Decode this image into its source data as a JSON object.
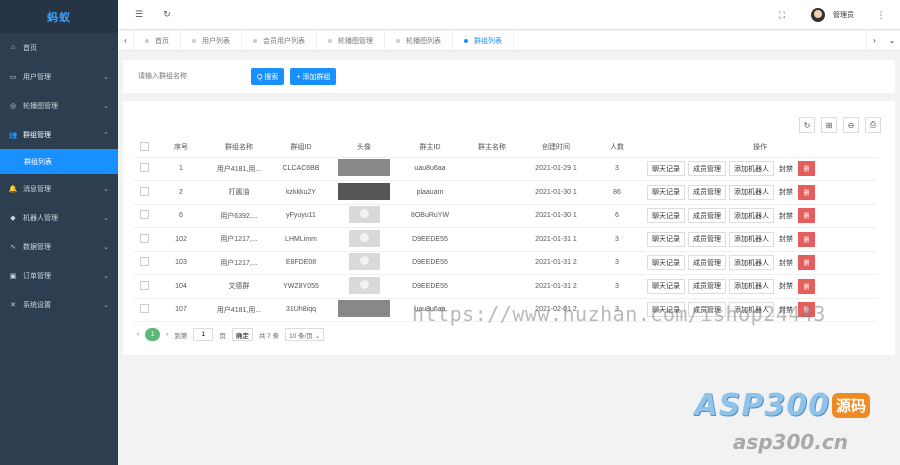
{
  "sidebar": {
    "logo": "蚂蚁",
    "items": [
      {
        "label": "首页",
        "icon": "home-icon",
        "glyph": "⌂",
        "chevron": ""
      },
      {
        "label": "用户管理",
        "icon": "user-icon",
        "glyph": "▭",
        "chevron": "⌄"
      },
      {
        "label": "轮播图管理",
        "icon": "image-icon",
        "glyph": "◎",
        "chevron": "⌄"
      },
      {
        "label": "群组管理",
        "icon": "group-icon",
        "glyph": "👥",
        "chevron": "⌃"
      }
    ],
    "submenu": {
      "label": "群组列表"
    },
    "items_after": [
      {
        "label": "消息管理",
        "icon": "bell-icon",
        "glyph": "🔔",
        "chevron": "⌄"
      },
      {
        "label": "机器人管理",
        "icon": "robot-icon",
        "glyph": "◆",
        "chevron": "⌄"
      },
      {
        "label": "数据管理",
        "icon": "chart-icon",
        "glyph": "∿",
        "chevron": "⌄"
      },
      {
        "label": "订单管理",
        "icon": "order-icon",
        "glyph": "▣",
        "chevron": "⌄"
      },
      {
        "label": "系统设置",
        "icon": "settings-icon",
        "glyph": "✕",
        "chevron": "⌄"
      }
    ]
  },
  "header": {
    "menu_glyph": "☰",
    "refresh_glyph": "↻",
    "fullscreen_glyph": "⛶",
    "user": "管理员",
    "more_glyph": "⋮"
  },
  "tabs": {
    "prev": "‹",
    "next": "›",
    "more": "⌄",
    "items": [
      {
        "label": "首页",
        "active": false
      },
      {
        "label": "用户列表",
        "active": false
      },
      {
        "label": "会员用户列表",
        "active": false
      },
      {
        "label": "轮播图管理",
        "active": false
      },
      {
        "label": "轮播图列表",
        "active": false
      },
      {
        "label": "群组列表",
        "active": true
      }
    ]
  },
  "search": {
    "placeholder": "请输入群组名称",
    "search_label": "Q 搜索",
    "add_label": "+ 添加群组"
  },
  "toolbar": {
    "refresh": "↻",
    "columns": "⊞",
    "export": "⊖",
    "print": "⎙"
  },
  "table": {
    "headers": [
      "",
      "序号",
      "群组名称",
      "群组ID",
      "头像",
      "群主ID",
      "群主名称",
      "创建时间",
      "人数",
      "操作"
    ],
    "rows": [
      {
        "seq": "1",
        "name": "用户4181,用...",
        "gid": "CLCAC6BB",
        "avatar": "photo",
        "owner": "uau8u6aa",
        "owner_name": "",
        "created": "2021-01-29 1",
        "count": "3"
      },
      {
        "seq": "2",
        "name": "打酱油",
        "gid": "kzkkku2Y",
        "avatar": "dark",
        "owner": "plaauam",
        "owner_name": "",
        "created": "2021-01-30 1",
        "count": "86"
      },
      {
        "seq": "6",
        "name": "用户6392,...",
        "gid": "yFyuyu11",
        "avatar": "person",
        "owner": "8OBuRuYW",
        "owner_name": "",
        "created": "2021-01-30 1",
        "count": "6"
      },
      {
        "seq": "102",
        "name": "用户1217,...",
        "gid": "LHMLimm",
        "avatar": "person",
        "owner": "D9EEDE55",
        "owner_name": "",
        "created": "2021-01-31 1",
        "count": "3"
      },
      {
        "seq": "103",
        "name": "用户1217,...",
        "gid": "E8FDE08",
        "avatar": "person",
        "owner": "D9EEDE55",
        "owner_name": "",
        "created": "2021-01-31 2",
        "count": "3"
      },
      {
        "seq": "104",
        "name": "文德群",
        "gid": "YWZ8Y055",
        "avatar": "person",
        "owner": "D9EEDE55",
        "owner_name": "",
        "created": "2021-01-31 2",
        "count": "3"
      },
      {
        "seq": "107",
        "name": "用户4181,用...",
        "gid": "31Uh8iqq",
        "avatar": "photo",
        "owner": "uau8u6aa",
        "owner_name": "",
        "created": "2021-02-01 2",
        "count": "3"
      }
    ],
    "ops": {
      "chat": "聊天记录",
      "members": "成员管理",
      "add_robot": "添加机器人",
      "ban": "封禁",
      "delete": "删"
    }
  },
  "pager": {
    "prev": "‹",
    "current": "1",
    "next": "›",
    "goto_label": "到第",
    "goto_value": "1",
    "page_unit": "页",
    "confirm": "确定",
    "total": "共 7 条",
    "per_page": "10 条/页 ⌄"
  },
  "watermark": {
    "url": "https://www.huzhan.com/ishop24443",
    "brand": "ASP300",
    "brand_tag": "源码",
    "domain": "asp300.cn"
  },
  "colors": {
    "accent": "#1890ff",
    "sidebar": "#2c3e50",
    "danger": "#e45e5e",
    "pager_active": "#5fb878"
  }
}
